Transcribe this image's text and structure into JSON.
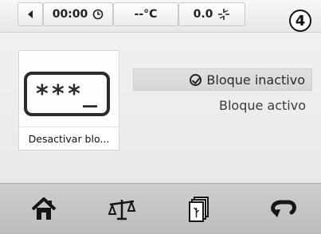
{
  "status_bar": {
    "time": "00:00",
    "temperature": "--°C",
    "fan_value": "0.0"
  },
  "step_badge": "4",
  "tile": {
    "icon_text": "***_",
    "label": "Desactivar blo..."
  },
  "options": [
    {
      "label": "Bloque inactivo",
      "selected": true
    },
    {
      "label": "Bloque activo",
      "selected": false
    }
  ],
  "icons": {
    "back": "back-triangle-icon",
    "clock": "clock-icon",
    "fan": "fan-icon",
    "check": "check-circle-icon",
    "home": "home-icon",
    "scale": "scale-icon",
    "recipes": "recipe-cards-icon",
    "return": "return-arrow-icon"
  }
}
